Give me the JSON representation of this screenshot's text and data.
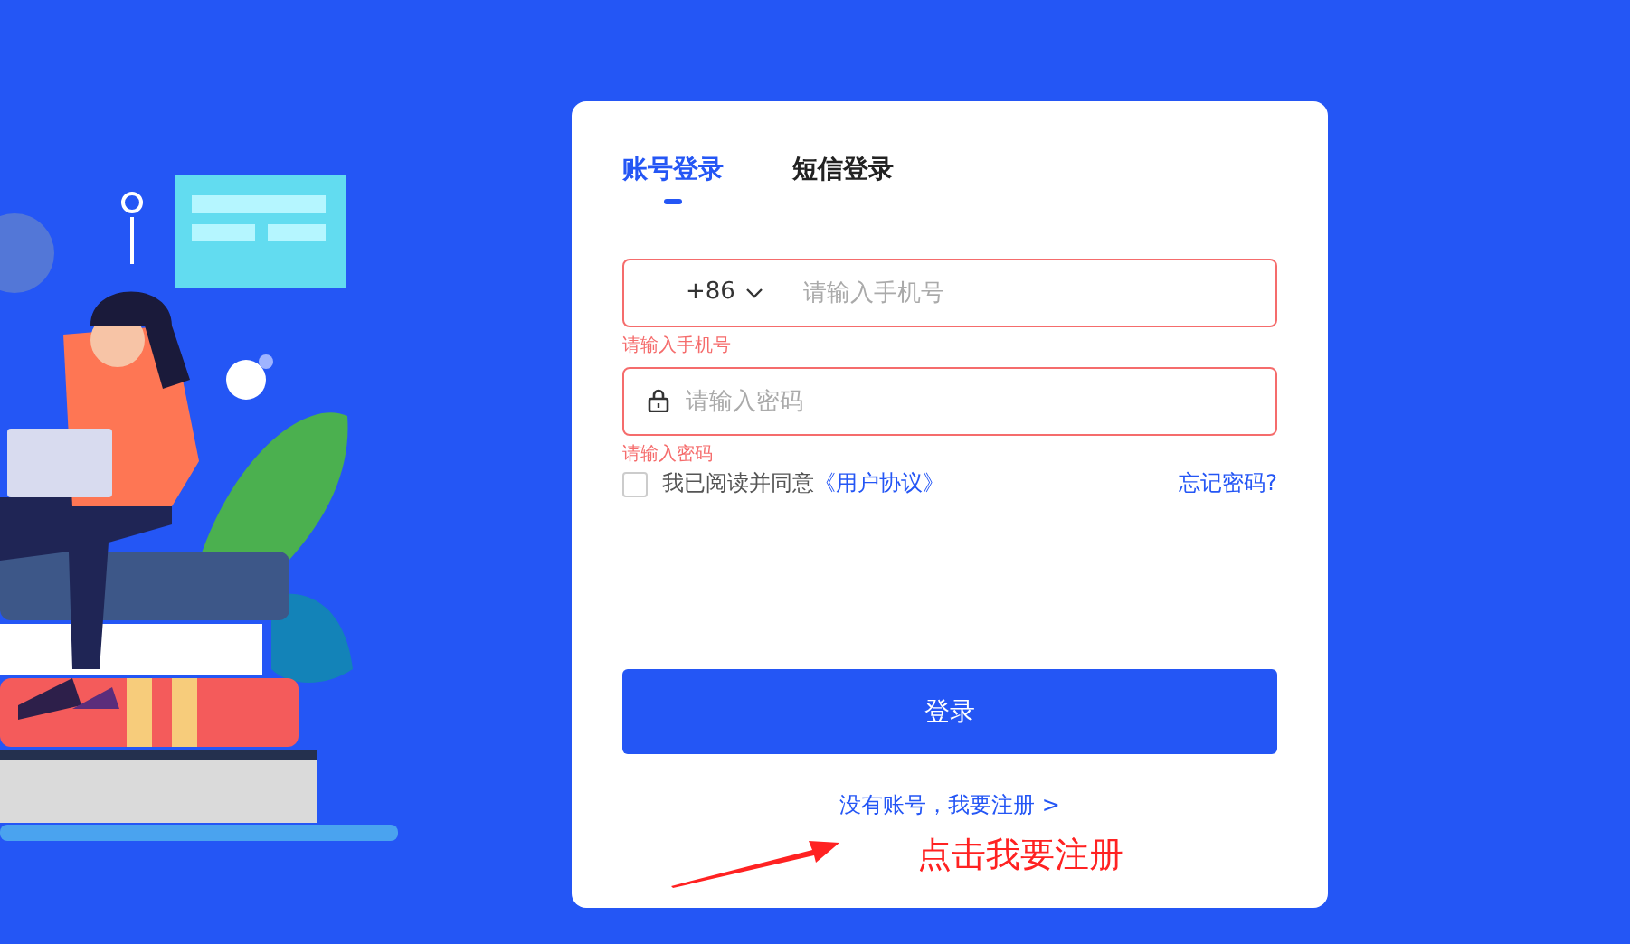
{
  "tabs": [
    {
      "label": "账号登录",
      "selected": true
    },
    {
      "label": "短信登录",
      "selected": false
    }
  ],
  "phone_field": {
    "country_code": "+86",
    "placeholder": "请输入手机号",
    "invalid": true,
    "error": "请输入手机号"
  },
  "password_field": {
    "placeholder": "请输入密码",
    "invalid": true,
    "error": "请输入密码"
  },
  "agreement": {
    "checked": false,
    "text": "我已阅读并同意",
    "link": "《用户协议》"
  },
  "forgot_password": "忘记密码?",
  "login_button": "登录",
  "register_link": "没有账号，我要注册 >",
  "annotation": "点击我要注册"
}
